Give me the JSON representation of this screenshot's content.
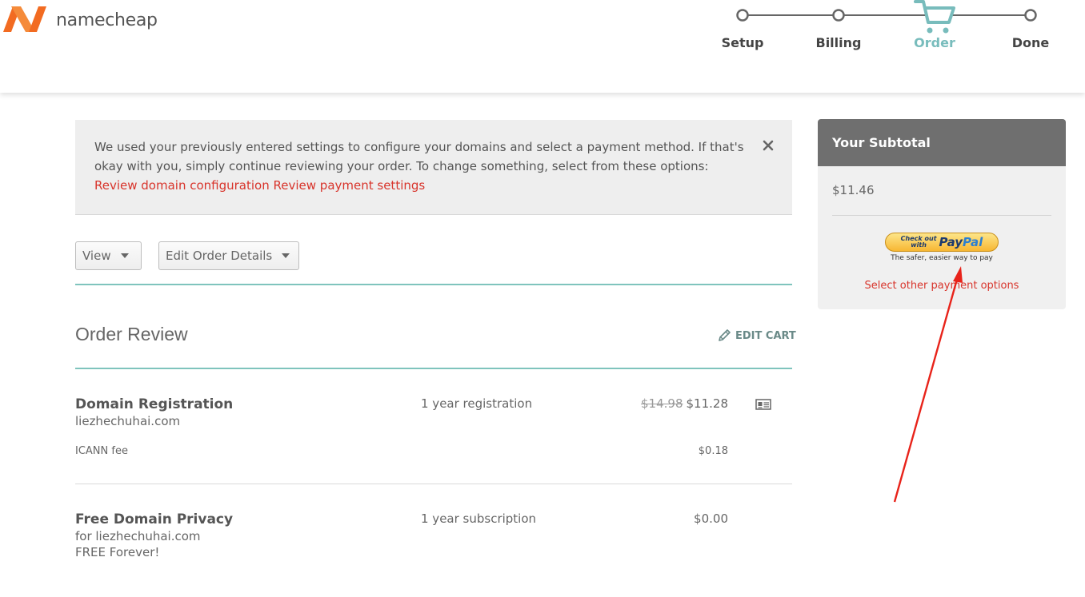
{
  "brand": {
    "name": "namecheap",
    "colors": {
      "logo_orange": "#f26b21",
      "teal": "#78bcbc",
      "link_red": "#d8342b"
    }
  },
  "steps": [
    {
      "label": "Setup",
      "state": "complete"
    },
    {
      "label": "Billing",
      "state": "complete"
    },
    {
      "label": "Order",
      "state": "active",
      "icon": "cart-icon"
    },
    {
      "label": "Done",
      "state": "pending"
    }
  ],
  "notice": {
    "text": "We used your previously entered settings to configure your domains and select a payment method. If that's okay with you, simply continue reviewing your order. To change something, select from these options: ",
    "link_domain": "Review domain configuration",
    "link_payment": "Review payment settings",
    "close_icon": "close-icon"
  },
  "toolbar": {
    "view_label": "View",
    "edit_details_label": "Edit Order Details"
  },
  "order_review": {
    "title": "Order Review",
    "edit_cart_label": "EDIT CART",
    "items": [
      {
        "title": "Domain Registration",
        "domain": "liezhechuhai.com",
        "term": "1 year registration",
        "old_price": "$14.98",
        "price": "$11.28",
        "fee_label": "ICANN fee",
        "fee_price": "$0.18"
      },
      {
        "title": "Free Domain Privacy",
        "subtitle": "for liezhechuhai.com",
        "note": "FREE Forever!",
        "term": "1 year subscription",
        "price": "$0.00"
      }
    ]
  },
  "subtotal": {
    "title": "Your Subtotal",
    "amount": "$11.46",
    "paypal": {
      "line1": "Check out",
      "line2": "with",
      "brand_pay": "Pay",
      "brand_pal": "Pal",
      "tagline": "The safer, easier way to pay"
    },
    "other_options": "Select other payment options"
  }
}
